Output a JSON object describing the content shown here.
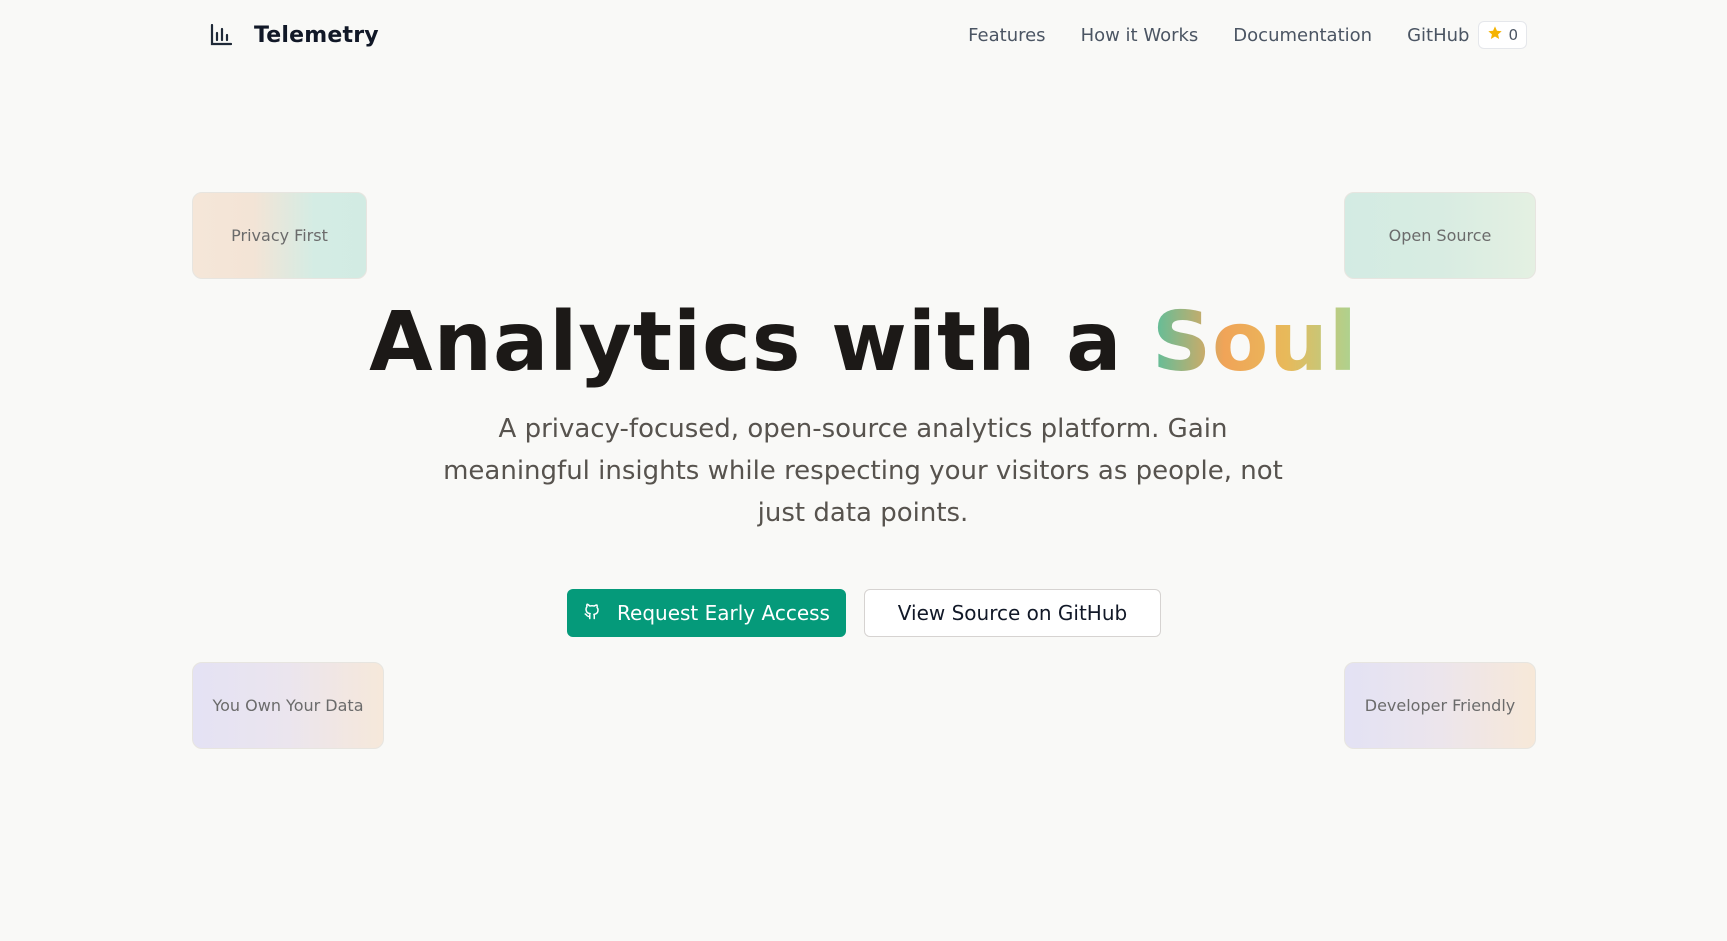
{
  "header": {
    "brand_icon": "bar-chart-icon",
    "brand_name": "Telemetry",
    "nav": [
      {
        "label": "Features"
      },
      {
        "label": "How it Works"
      },
      {
        "label": "Documentation"
      },
      {
        "label": "GitHub"
      }
    ],
    "github_stars": "0",
    "star_icon": "star-icon",
    "star_color": "#f5b301"
  },
  "floating_cards": {
    "privacy_first": "Privacy First",
    "open_source": "Open Source",
    "own_data": "You Own Your Data",
    "developer_friendly": "Developer Friendly"
  },
  "hero": {
    "title_main": "Analytics with a ",
    "title_accent": "Soul",
    "subtitle": "A privacy-focused, open-source analytics platform. Gain meaningful insights while respecting your visitors as people, not just data points."
  },
  "actions": {
    "primary_label": "Request Early Access",
    "primary_icon": "github-icon",
    "secondary_label": "View Source on GitHub"
  },
  "colors": {
    "accent": "#059a7a",
    "background": "#f9f9f7",
    "title": "#1c1917"
  }
}
